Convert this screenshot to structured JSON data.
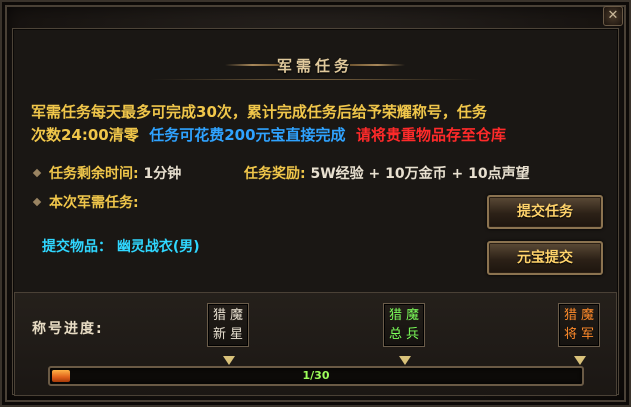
{
  "window": {
    "title": "军需任务",
    "close_glyph": "✕"
  },
  "description": {
    "line1": "军需任务每天最多可完成30次，累计完成任务后给予荣耀称号，任务",
    "line2_a": "次数24:00清零",
    "line2_b": "任务可花费200元宝直接完成",
    "line2_c": "请将贵重物品存至仓库"
  },
  "info": {
    "time_label": "任务剩余时间:",
    "time_value": "1分钟",
    "reward_label": "任务奖励:",
    "reward_value": "5W经验 + 10万金币 + 10点声望",
    "current_label": "本次军需任务:"
  },
  "attachment": {
    "label": "提交物品：",
    "value": "幽灵战衣(男)"
  },
  "buttons": {
    "submit": "提交任务",
    "yuanbao": "元宝提交"
  },
  "progress": {
    "label": "称号进度:",
    "current": 1,
    "max": 30,
    "text": "1/30",
    "titles": [
      {
        "line1": "猎魔",
        "line2": "新星",
        "color": "#e8e0d0"
      },
      {
        "line1": "猎魔",
        "line2": "总兵",
        "color": "#7cff5a"
      },
      {
        "line1": "猎魔",
        "line2": "将军",
        "color": "#ff8a2a"
      }
    ]
  }
}
